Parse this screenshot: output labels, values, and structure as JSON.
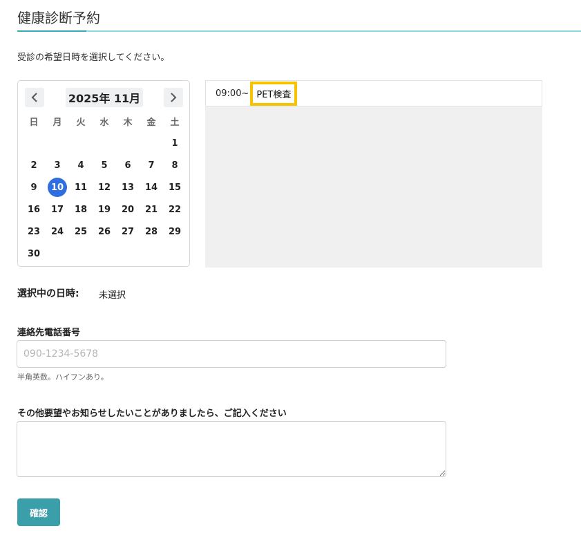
{
  "page": {
    "title": "健康診断予約",
    "instruction": "受診の希望日時を選択してください。",
    "accent_color": "#3aa9b6"
  },
  "calendar": {
    "prev_icon": "chevron-left-icon",
    "next_icon": "chevron-right-icon",
    "month_label": "2025年 11月",
    "weekdays": [
      "日",
      "月",
      "火",
      "水",
      "木",
      "金",
      "土"
    ],
    "weeks": [
      [
        "",
        "",
        "",
        "",
        "",
        "",
        "1"
      ],
      [
        "2",
        "3",
        "4",
        "5",
        "6",
        "7",
        "8"
      ],
      [
        "9",
        "10",
        "11",
        "12",
        "13",
        "14",
        "15"
      ],
      [
        "16",
        "17",
        "18",
        "19",
        "20",
        "21",
        "22"
      ],
      [
        "23",
        "24",
        "25",
        "26",
        "27",
        "28",
        "29"
      ],
      [
        "30",
        "",
        "",
        "",
        "",
        "",
        ""
      ]
    ],
    "selected_day": "10",
    "selected_color": "#2f6ee0"
  },
  "slots": [
    {
      "time": "09:00~",
      "name": "PET検査",
      "highlight_color": "#f5c400"
    }
  ],
  "selection": {
    "label": "選択中の日時:",
    "value": "未選択"
  },
  "phone": {
    "label": "連絡先電話番号",
    "placeholder": "090-1234-5678",
    "value": "",
    "hint": "半角英数。ハイフンあり。"
  },
  "notes": {
    "label": "その他要望やお知らせしたいことがありましたら、ご記入ください",
    "value": ""
  },
  "actions": {
    "confirm_label": "確認",
    "confirm_color": "#3a9fa8"
  }
}
